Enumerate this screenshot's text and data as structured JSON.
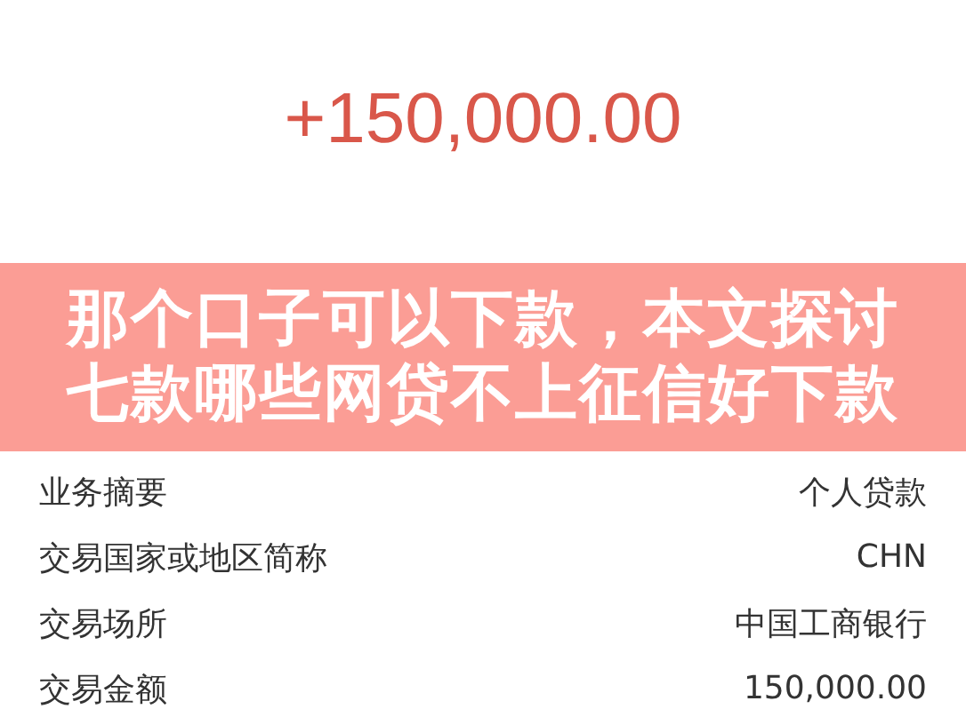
{
  "amount": "+150,000.00",
  "banner": {
    "lines": [
      "那个口子可以下款，本文探讨",
      "七款哪些网贷不上征信好下款"
    ]
  },
  "rows": [
    {
      "label": "业务摘要",
      "value": "个人贷款"
    },
    {
      "label": "交易国家或地区简称",
      "value": "CHN"
    },
    {
      "label": "交易场所",
      "value": "中国工商银行"
    },
    {
      "label": "交易金额",
      "value": "150,000.00"
    }
  ]
}
